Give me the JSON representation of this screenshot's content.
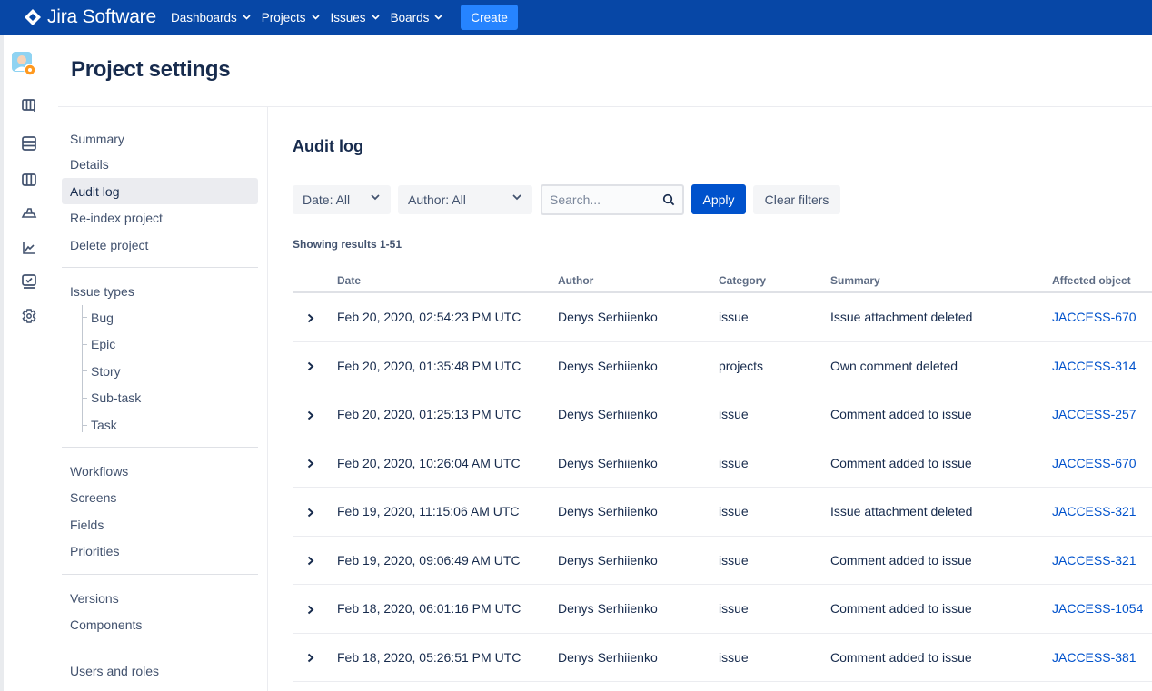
{
  "topnav": {
    "brand": "Jira Software",
    "items": [
      {
        "label": "Dashboards"
      },
      {
        "label": "Projects"
      },
      {
        "label": "Issues"
      },
      {
        "label": "Boards"
      }
    ],
    "create_label": "Create",
    "colors": {
      "bar": "#0747a6",
      "create": "#2684ff"
    }
  },
  "rail": {
    "icons": [
      "project-avatar-icon",
      "board-icon",
      "backlog-icon",
      "columns-icon",
      "releases-icon",
      "reports-icon",
      "issues-icon",
      "settings-icon"
    ]
  },
  "page": {
    "title": "Project settings"
  },
  "sidebar": {
    "group1": [
      "Summary",
      "Details",
      "Audit log",
      "Re-index project",
      "Delete project"
    ],
    "issue_types": {
      "label": "Issue types",
      "children": [
        "Bug",
        "Epic",
        "Story",
        "Sub-task",
        "Task"
      ]
    },
    "group3": [
      "Workflows",
      "Screens",
      "Fields",
      "Priorities"
    ],
    "group4": [
      "Versions",
      "Components"
    ],
    "group5": [
      "Users and roles"
    ],
    "active": "Audit log"
  },
  "audit": {
    "title": "Audit log",
    "filters": {
      "date_label": "Date: All",
      "author_label": "Author: All",
      "search_placeholder": "Search...",
      "apply_label": "Apply",
      "clear_label": "Clear filters"
    },
    "results_text": "Showing results 1-51",
    "columns": [
      "Date",
      "Author",
      "Category",
      "Summary",
      "Affected object"
    ],
    "rows": [
      {
        "date": "Feb 20, 2020, 02:54:23 PM UTC",
        "author": "Denys Serhiienko",
        "category": "issue",
        "summary": "Issue attachment deleted",
        "object": "JACCESS-670"
      },
      {
        "date": "Feb 20, 2020, 01:35:48 PM UTC",
        "author": "Denys Serhiienko",
        "category": "projects",
        "summary": "Own comment deleted",
        "object": "JACCESS-314"
      },
      {
        "date": "Feb 20, 2020, 01:25:13 PM UTC",
        "author": "Denys Serhiienko",
        "category": "issue",
        "summary": "Comment added to issue",
        "object": "JACCESS-257"
      },
      {
        "date": "Feb 20, 2020, 10:26:04 AM UTC",
        "author": "Denys Serhiienko",
        "category": "issue",
        "summary": "Comment added to issue",
        "object": "JACCESS-670"
      },
      {
        "date": "Feb 19, 2020, 11:15:06 AM UTC",
        "author": "Denys Serhiienko",
        "category": "issue",
        "summary": "Issue attachment deleted",
        "object": "JACCESS-321"
      },
      {
        "date": "Feb 19, 2020, 09:06:49 AM UTC",
        "author": "Denys Serhiienko",
        "category": "issue",
        "summary": "Comment added to issue",
        "object": "JACCESS-321"
      },
      {
        "date": "Feb 18, 2020, 06:01:16 PM UTC",
        "author": "Denys Serhiienko",
        "category": "issue",
        "summary": "Comment added to issue",
        "object": "JACCESS-1054"
      },
      {
        "date": "Feb 18, 2020, 05:26:51 PM UTC",
        "author": "Denys Serhiienko",
        "category": "issue",
        "summary": "Comment added to issue",
        "object": "JACCESS-381"
      }
    ]
  }
}
